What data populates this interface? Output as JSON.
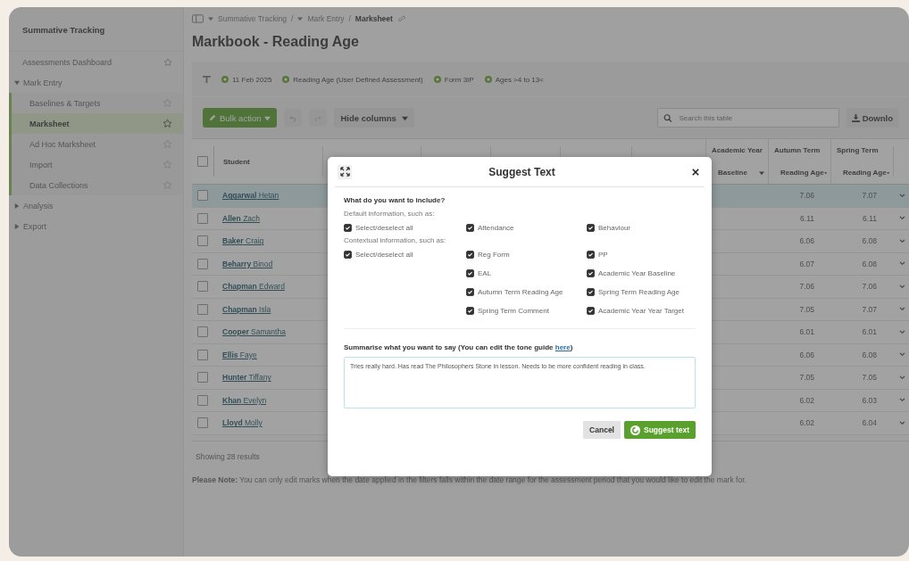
{
  "sidebar": {
    "title": "Summative Tracking",
    "items": [
      {
        "kind": "page",
        "label": "Assessments Dashboard",
        "selected": false
      },
      {
        "kind": "section",
        "label": "Mark Entry",
        "selected": false,
        "expanded": true,
        "children": [
          {
            "kind": "page",
            "label": "Baselines & Targets",
            "selected": false
          },
          {
            "kind": "page",
            "label": "Marksheet",
            "selected": true
          },
          {
            "kind": "page",
            "label": "Ad Hoc Marksheet",
            "selected": false
          },
          {
            "kind": "page",
            "label": "Import",
            "selected": false
          },
          {
            "kind": "page",
            "label": "Data Collections",
            "selected": false
          }
        ]
      },
      {
        "kind": "section",
        "label": "Analysis",
        "selected": false,
        "expanded": false
      },
      {
        "kind": "section",
        "label": "Export",
        "selected": false,
        "expanded": false
      }
    ]
  },
  "breadcrumb": [
    {
      "kind": "link",
      "label": "Summative Tracking",
      "dropdown": true
    },
    {
      "kind": "separator",
      "label": "/"
    },
    {
      "kind": "link",
      "label": "Mark Entry",
      "dropdown": true
    },
    {
      "kind": "separator",
      "label": "/"
    },
    {
      "kind": "link",
      "label": "Marksheet",
      "dropdown": false
    }
  ],
  "page_title": "Markbook - Reading Age",
  "filters": [
    "11 Feb 2025",
    "Reading Age (User Defined Assessment)",
    "Form 3IP",
    "Ages >4 to 13<"
  ],
  "toolbar": {
    "bulk_action": "Bulk action",
    "hide_columns": "Hide columns",
    "search": {
      "placeholder": "Search this table"
    },
    "download": "Downlo"
  },
  "table": {
    "select_all_checked": false,
    "student_header": "Student",
    "grade_columns": [
      {
        "line1": "Academic Year",
        "line2": "Baseline"
      },
      {
        "line1": "Autumn Term",
        "line2": "Reading Age"
      },
      {
        "line1": "Spring Term",
        "line2": "Reading Age"
      }
    ],
    "rows": [
      {
        "surname": "Aggarwal",
        "forename": "Hetan",
        "selected": true,
        "checked": false,
        "marks": [
          "7.06",
          "7.07"
        ]
      },
      {
        "surname": "Allen",
        "forename": "Zach",
        "selected": false,
        "checked": false,
        "marks": [
          "6.11",
          "6.11"
        ]
      },
      {
        "surname": "Baker",
        "forename": "Craig",
        "selected": false,
        "checked": false,
        "marks": [
          "6.06",
          "6.08"
        ]
      },
      {
        "surname": "Beharry",
        "forename": "Binod",
        "selected": false,
        "checked": false,
        "marks": [
          "6.07",
          "6.08"
        ]
      },
      {
        "surname": "Chapman",
        "forename": "Edward",
        "selected": false,
        "checked": false,
        "marks": [
          "7.06",
          "7.06"
        ]
      },
      {
        "surname": "Chapman",
        "forename": "Isla",
        "selected": false,
        "checked": false,
        "marks": [
          "7.05",
          "7.07"
        ]
      },
      {
        "surname": "Cooper",
        "forename": "Samantha",
        "selected": false,
        "checked": false,
        "marks": [
          "6.01",
          "6.01"
        ]
      },
      {
        "surname": "Ellis",
        "forename": "Faye",
        "selected": false,
        "checked": false,
        "marks": [
          "6.06",
          "6.08"
        ]
      },
      {
        "surname": "Hunter",
        "forename": "Tiffany",
        "selected": false,
        "checked": false,
        "marks": [
          "7.05",
          "7.05"
        ]
      },
      {
        "surname": "Khan",
        "forename": "Evelyn",
        "selected": false,
        "checked": false,
        "marks": [
          "6.02",
          "6.03"
        ]
      },
      {
        "surname": "Lloyd",
        "forename": "Molly",
        "selected": false,
        "checked": false,
        "marks": [
          "6.02",
          "6.04"
        ]
      }
    ]
  },
  "results": "Showing 28 results",
  "note": "**Please Note:** You can only edit marks when the date applied in the filters falls within the date range for the assessment period that you would like to edit the mark for.",
  "modal": {
    "title": "Suggest Text",
    "question": "What do you want to include?",
    "groups": [
      {
        "label": "Default information, such as:",
        "select_all": {
          "label": "Select/deselect all",
          "checked": true
        },
        "options": [
          {
            "label": "Attendance",
            "checked": true
          },
          {
            "label": "Behaviour",
            "checked": true
          }
        ]
      },
      {
        "label": "Contextual information, such as:",
        "select_all": {
          "label": "Select/deselect all",
          "checked": true
        },
        "options": [
          {
            "label": "Reg Form",
            "checked": true
          },
          {
            "label": "PP",
            "checked": true
          },
          {
            "label": "EAL",
            "checked": true
          },
          {
            "label": "Academic Year Baseline",
            "checked": true
          },
          {
            "label": "Autumn Term Reading Age",
            "checked": true
          },
          {
            "label": "Spring Term Reading Age",
            "checked": true
          },
          {
            "label": "Spring Term Comment",
            "checked": true
          },
          {
            "label": "Academic Year Year Target",
            "checked": true
          }
        ]
      }
    ],
    "summary_label": "Summarise what you want to say (You can edit the tone guide ",
    "summary_link": "here",
    "summary_end": ")",
    "summary_value": "Tries really hard. Has read The Philosophers Stone in lesson. Needs to be more confident reading in class.",
    "cancel": "Cancel",
    "submit": "Suggest text"
  }
}
